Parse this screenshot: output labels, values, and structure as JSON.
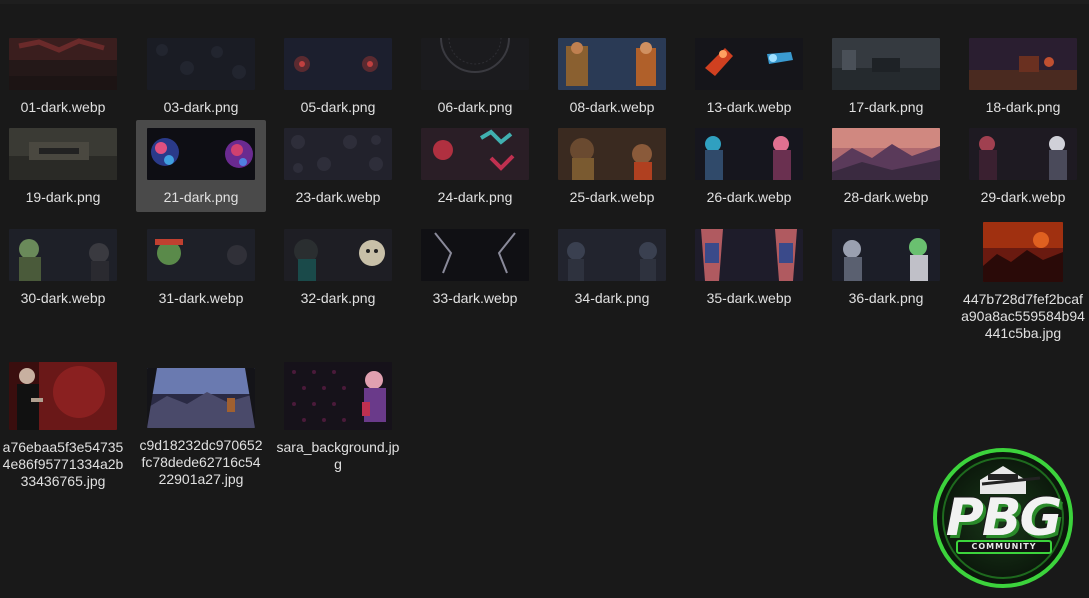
{
  "files": [
    {
      "name": "01-dark.webp"
    },
    {
      "name": "03-dark.png"
    },
    {
      "name": "05-dark.png"
    },
    {
      "name": "06-dark.png"
    },
    {
      "name": "08-dark.webp"
    },
    {
      "name": "13-dark.webp"
    },
    {
      "name": "17-dark.png"
    },
    {
      "name": "18-dark.png"
    },
    {
      "name": "19-dark.png"
    },
    {
      "name": "21-dark.png"
    },
    {
      "name": "23-dark.webp"
    },
    {
      "name": "24-dark.png"
    },
    {
      "name": "25-dark.webp"
    },
    {
      "name": "26-dark.webp"
    },
    {
      "name": "28-dark.webp"
    },
    {
      "name": "29-dark.webp"
    },
    {
      "name": "30-dark.webp"
    },
    {
      "name": "31-dark.webp"
    },
    {
      "name": "32-dark.png"
    },
    {
      "name": "33-dark.webp"
    },
    {
      "name": "34-dark.png"
    },
    {
      "name": "35-dark.webp"
    },
    {
      "name": "36-dark.png"
    },
    {
      "name": "447b728d7fef2bcafa90a8ac559584b94441c5ba.jpg"
    },
    {
      "name": "a76ebaa5f3e547354e86f95771334a2b33436765.jpg"
    },
    {
      "name": "c9d18232dc970652fc78dede62716c5422901a27.jpg"
    },
    {
      "name": "sara_background.jpg"
    }
  ],
  "selected_file": "21-dark.png",
  "logo": {
    "text": "PBG",
    "subtext": "COMMUNITY",
    "accent_color": "#3cd33c"
  },
  "colors": {
    "background": "#191919",
    "selection": "#4a4a4a",
    "label": "#e0e0e0"
  }
}
